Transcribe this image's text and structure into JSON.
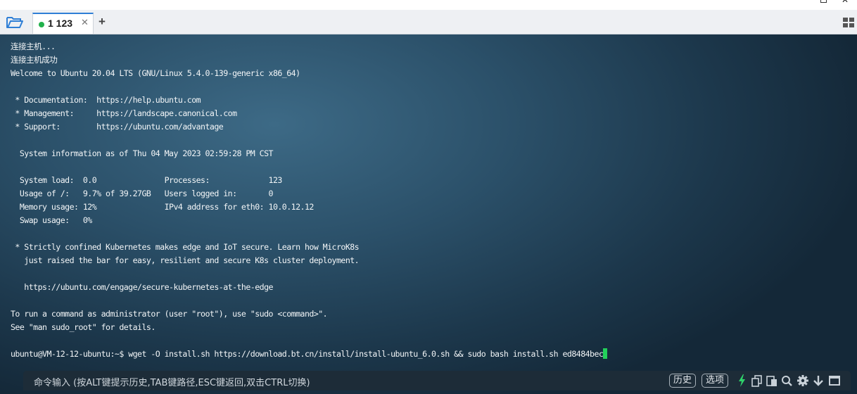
{
  "tabs": [
    {
      "label": "1 123",
      "status_color": "#22b14c",
      "active": true
    }
  ],
  "terminal": {
    "lines": [
      "连接主机...",
      "连接主机成功",
      "Welcome to Ubuntu 20.04 LTS (GNU/Linux 5.4.0-139-generic x86_64)",
      "",
      " * Documentation:  https://help.ubuntu.com",
      " * Management:     https://landscape.canonical.com",
      " * Support:        https://ubuntu.com/advantage",
      "",
      "  System information as of Thu 04 May 2023 02:59:28 PM CST",
      "",
      "  System load:  0.0               Processes:             123",
      "  Usage of /:   9.7% of 39.27GB   Users logged in:       0",
      "  Memory usage: 12%               IPv4 address for eth0: 10.0.12.12",
      "  Swap usage:   0%",
      "",
      " * Strictly confined Kubernetes makes edge and IoT secure. Learn how MicroK8s",
      "   just raised the bar for easy, resilient and secure K8s cluster deployment.",
      "",
      "   https://ubuntu.com/engage/secure-kubernetes-at-the-edge",
      "",
      "To run a command as administrator (user \"root\"), use \"sudo <command>\".",
      "See \"man sudo_root\" for details.",
      ""
    ],
    "prompt": "ubuntu@VM-12-12-ubuntu:~$ ",
    "command": "wget -O install.sh https://download.bt.cn/install/install-ubuntu_6.0.sh && sudo bash install.sh ed8484bec",
    "cursor_color": "#22d05a"
  },
  "command_bar": {
    "placeholder": "命令输入 (按ALT键提示历史,TAB键路径,ESC键返回,双击CTRL切换)",
    "history_label": "历史",
    "options_label": "选项"
  },
  "icons": [
    "folder-open-icon",
    "close-icon",
    "plus-icon",
    "grid-layout-icon",
    "lightning-icon",
    "copy-icon",
    "paste-icon",
    "search-icon",
    "gear-icon",
    "arrow-down-icon",
    "maximize-icon"
  ]
}
